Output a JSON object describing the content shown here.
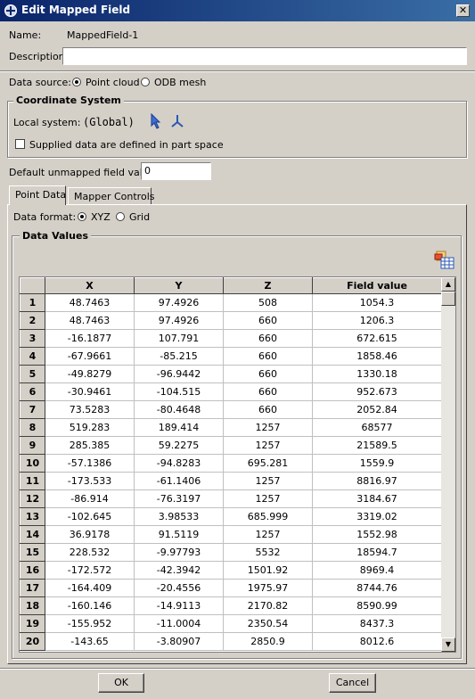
{
  "window": {
    "title": "Edit Mapped Field",
    "close_glyph": "✕"
  },
  "name": {
    "label": "Name:",
    "value": "MappedField-1"
  },
  "description": {
    "label": "Description:",
    "value": ""
  },
  "data_source": {
    "label": "Data source:",
    "options": [
      "Point cloud",
      "ODB mesh"
    ],
    "selected": "Point cloud"
  },
  "coordinate_system": {
    "title": "Coordinate System",
    "local_label": "Local system:",
    "local_value": "(Global)",
    "supplied_label": "Supplied data are defined in part space",
    "supplied_checked": false
  },
  "default_unmapped": {
    "label": "Default unmapped field value:",
    "value": "0"
  },
  "tabs": [
    {
      "label": "Point Data",
      "active": true
    },
    {
      "label": "Mapper Controls",
      "active": false
    }
  ],
  "data_format": {
    "label": "Data format:",
    "options": [
      "XYZ",
      "Grid"
    ],
    "selected": "XYZ"
  },
  "data_values": {
    "title": "Data Values",
    "columns": [
      "X",
      "Y",
      "Z",
      "Field value"
    ],
    "rows": [
      [
        "1",
        "48.7463",
        "97.4926",
        "508",
        "1054.3"
      ],
      [
        "2",
        "48.7463",
        "97.4926",
        "660",
        "1206.3"
      ],
      [
        "3",
        "-16.1877",
        "107.791",
        "660",
        "672.615"
      ],
      [
        "4",
        "-67.9661",
        "-85.215",
        "660",
        "1858.46"
      ],
      [
        "5",
        "-49.8279",
        "-96.9442",
        "660",
        "1330.18"
      ],
      [
        "6",
        "-30.9461",
        "-104.515",
        "660",
        "952.673"
      ],
      [
        "7",
        "73.5283",
        "-80.4648",
        "660",
        "2052.84"
      ],
      [
        "8",
        "519.283",
        "189.414",
        "1257",
        "68577"
      ],
      [
        "9",
        "285.385",
        "59.2275",
        "1257",
        "21589.5"
      ],
      [
        "10",
        "-57.1386",
        "-94.8283",
        "695.281",
        "1559.9"
      ],
      [
        "11",
        "-173.533",
        "-61.1406",
        "1257",
        "8816.97"
      ],
      [
        "12",
        "-86.914",
        "-76.3197",
        "1257",
        "3184.67"
      ],
      [
        "13",
        "-102.645",
        "3.98533",
        "685.999",
        "3319.02"
      ],
      [
        "14",
        "36.9178",
        "91.5119",
        "1257",
        "1552.98"
      ],
      [
        "15",
        "228.532",
        "-9.97793",
        "5532",
        "18594.7"
      ],
      [
        "16",
        "-172.572",
        "-42.3942",
        "1501.92",
        "8969.4"
      ],
      [
        "17",
        "-164.409",
        "-20.4556",
        "1975.97",
        "8744.76"
      ],
      [
        "18",
        "-160.146",
        "-14.9113",
        "2170.82",
        "8590.99"
      ],
      [
        "19",
        "-155.952",
        "-11.0004",
        "2350.54",
        "8437.3"
      ],
      [
        "20",
        "-143.65",
        "-3.80907",
        "2850.9",
        "8012.6"
      ]
    ]
  },
  "buttons": {
    "ok": "OK",
    "cancel": "Cancel"
  }
}
